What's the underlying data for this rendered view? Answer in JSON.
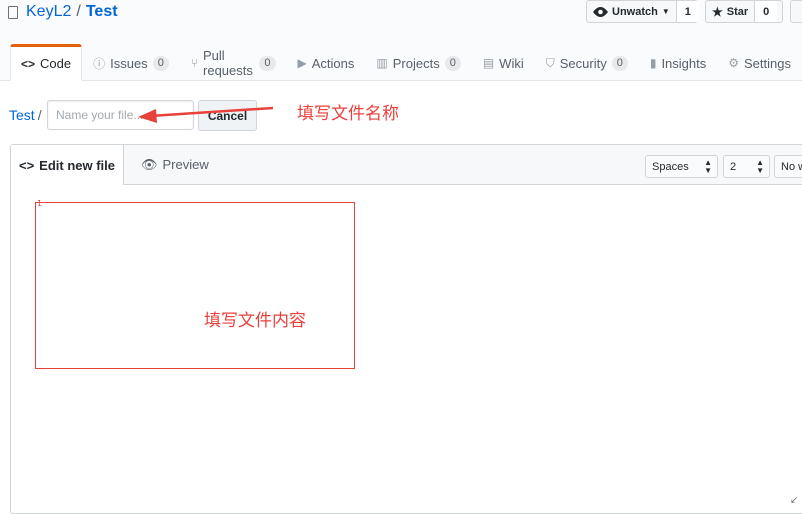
{
  "repo": {
    "owner": "KeyL2",
    "separator": "/",
    "name": "Test"
  },
  "header_buttons": {
    "watch": {
      "label": "Unwatch",
      "count": "1"
    },
    "star": {
      "label": "Star",
      "count": "0"
    }
  },
  "tabs": [
    {
      "label": "Code",
      "icon": "code-icon"
    },
    {
      "label": "Issues",
      "count": "0",
      "icon": "issue-icon"
    },
    {
      "label": "Pull requests",
      "count": "0",
      "icon": "pull-request-icon"
    },
    {
      "label": "Actions",
      "icon": "play-icon"
    },
    {
      "label": "Projects",
      "count": "0",
      "icon": "project-icon"
    },
    {
      "label": "Wiki",
      "icon": "book-icon"
    },
    {
      "label": "Security",
      "count": "0",
      "icon": "shield-icon"
    },
    {
      "label": "Insights",
      "icon": "graph-icon"
    },
    {
      "label": "Settings",
      "icon": "gear-icon"
    }
  ],
  "breadcrumb": {
    "repo": "Test",
    "sep": "/"
  },
  "filename": {
    "placeholder": "Name your file...",
    "value": ""
  },
  "cancel_label": "Cancel",
  "editor": {
    "edit_tab": "Edit new file",
    "preview_tab": "Preview",
    "indent_mode": "Spaces",
    "indent_size": "2",
    "wrap_mode": "No wrap",
    "line_number": "1"
  },
  "annotations": {
    "filename_hint": "填写文件名称",
    "content_hint": "填写文件内容"
  },
  "colors": {
    "accent": "#e36209",
    "link": "#0366d6",
    "annotation": "#e8413c"
  }
}
